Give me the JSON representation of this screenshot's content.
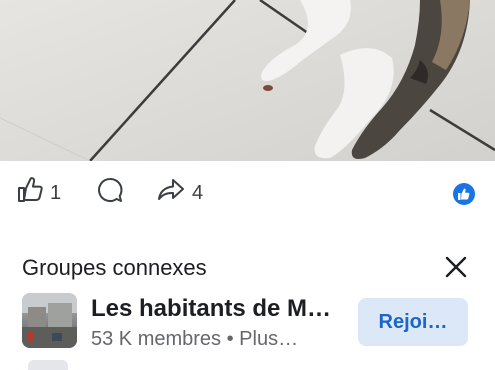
{
  "post": {
    "like_count": "1",
    "share_count": "4"
  },
  "related": {
    "title": "Groupes connexes",
    "group": {
      "name": "Les habitants de M…",
      "meta": "53 K membres • Plus…",
      "join_label": "Rejoi…"
    }
  },
  "colors": {
    "accent": "#1b74e4",
    "join_bg": "#dce8f7",
    "join_text": "#1b66c9"
  },
  "icons": [
    "thumbs-up-icon",
    "comment-icon",
    "share-icon",
    "like-reaction-icon",
    "close-icon"
  ]
}
